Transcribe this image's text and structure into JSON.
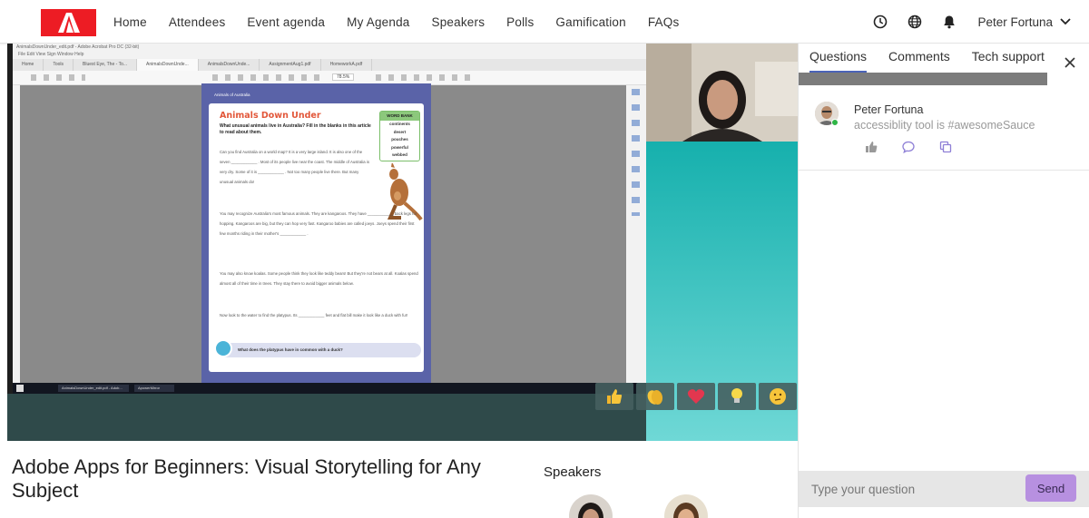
{
  "nav": {
    "logo_letter": "A",
    "items": [
      "Home",
      "Attendees",
      "Event agenda",
      "My Agenda",
      "Speakers",
      "Polls",
      "Gamification",
      "FAQs"
    ],
    "user_name": "Peter Fortuna"
  },
  "pdf": {
    "window_title": "AnimalsDownUnder_edit.pdf - Adobe Acrobat Pro DC (32-bit)",
    "menu": "File   Edit   View   Sign   Window   Help",
    "tabs": [
      "Home",
      "Tools",
      "Bluest Eye, The - To...",
      "AnimalsDownUnde...",
      "AnimalsDownUnde...",
      "AssignmentAug1.pdf",
      "HomeworkA.pdf"
    ],
    "zoom": "78.5%",
    "kicker": "Animals of Australia",
    "title": "Animals Down Under",
    "subtitle": "What unusual animals live in Australia? Fill in the blanks in this article to read about them.",
    "word_bank_title": "WORD BANK",
    "word_bank": [
      "continents",
      "desert",
      "pouches",
      "powerful",
      "webbed"
    ],
    "para1": "Can you find Australia on a world map? It is a very large island. It is also one of the seven ____________ . Most of its people live near the coast. The middle of Australia is very dry. Some of it is ____________ . Not too many people live there. But many unusual animals do!",
    "para2": "You may recognize Australia's most famous animals. They are kangaroos. They have ____________ back legs for hopping. Kangaroos are big, but they can hop very fast. Kangaroo babies are called joeys. Joeys spend their first few months riding in their mother's ____________ .",
    "para3": "You may also know koalas. Some people think they look like teddy bears! But they're not bears at all. Koalas spend almost all of their time in trees. They stay there to avoid bigger animals below.",
    "para4": "Now look to the water to find the platypus. Its ____________ feet and flat bill make it look like a duck with fur!",
    "question": "What does the platypus have in common with a duck?",
    "taskbar_item1": "AnimalsDownUnder_edit.pdf - Adob...",
    "taskbar_item2": "ApowerMirror"
  },
  "session": {
    "title": "Adobe Apps for Beginners: Visual Storytelling for Any Subject",
    "speakers_heading": "Speakers"
  },
  "panel": {
    "tabs": [
      "Questions",
      "Comments",
      "Tech support"
    ],
    "question": {
      "author": "Peter Fortuna",
      "text": "accessiblity tool is #awesomeSauce"
    },
    "input_placeholder": "Type your question",
    "send_label": "Send"
  },
  "reactions": [
    "thumbs-up",
    "clapping",
    "heart",
    "lightbulb",
    "thinking"
  ],
  "colors": {
    "brand_red": "#ed1c24",
    "tab_underline": "#4b63b8",
    "send_button": "#b790e0",
    "online": "#2fb546",
    "teal": "#16b0ad"
  }
}
